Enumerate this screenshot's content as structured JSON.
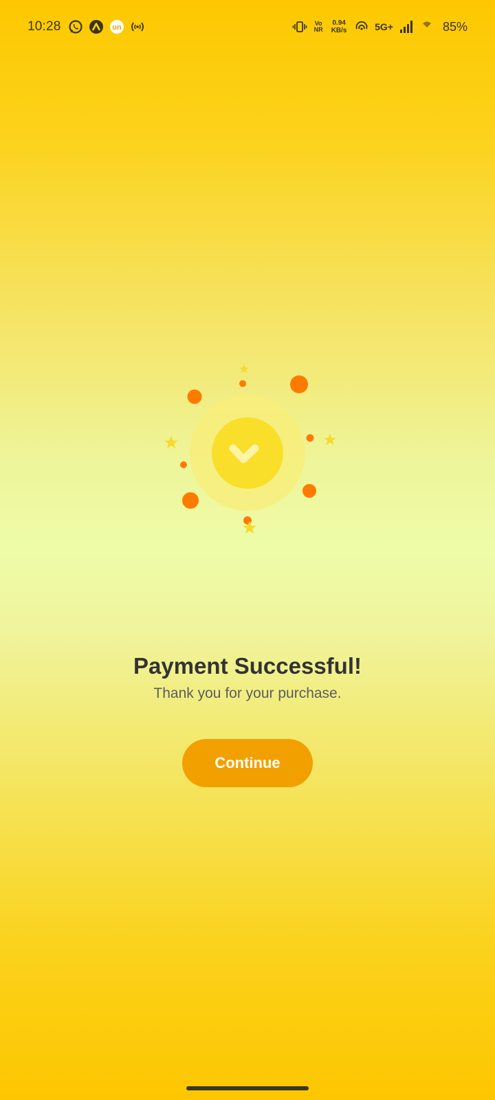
{
  "status_bar": {
    "time": "10:28",
    "left_icons": [
      "whatsapp-icon",
      "arc-app-icon",
      "un-app-icon",
      "hotspot-icon"
    ],
    "un_label": "un",
    "volte_top": "Vo",
    "volte_bottom": "NR",
    "net_speed_value": "0.94",
    "net_speed_unit": "KB/s",
    "network_type": "5G+",
    "battery": "85%"
  },
  "success": {
    "title": "Payment Successful!",
    "subtitle": "Thank you for your purchase.",
    "continue_label": "Continue"
  },
  "colors": {
    "accent_orange": "#ff7a00",
    "button": "#f2a000",
    "check_circle": "#f9df2a",
    "star": "#f7d92a"
  }
}
